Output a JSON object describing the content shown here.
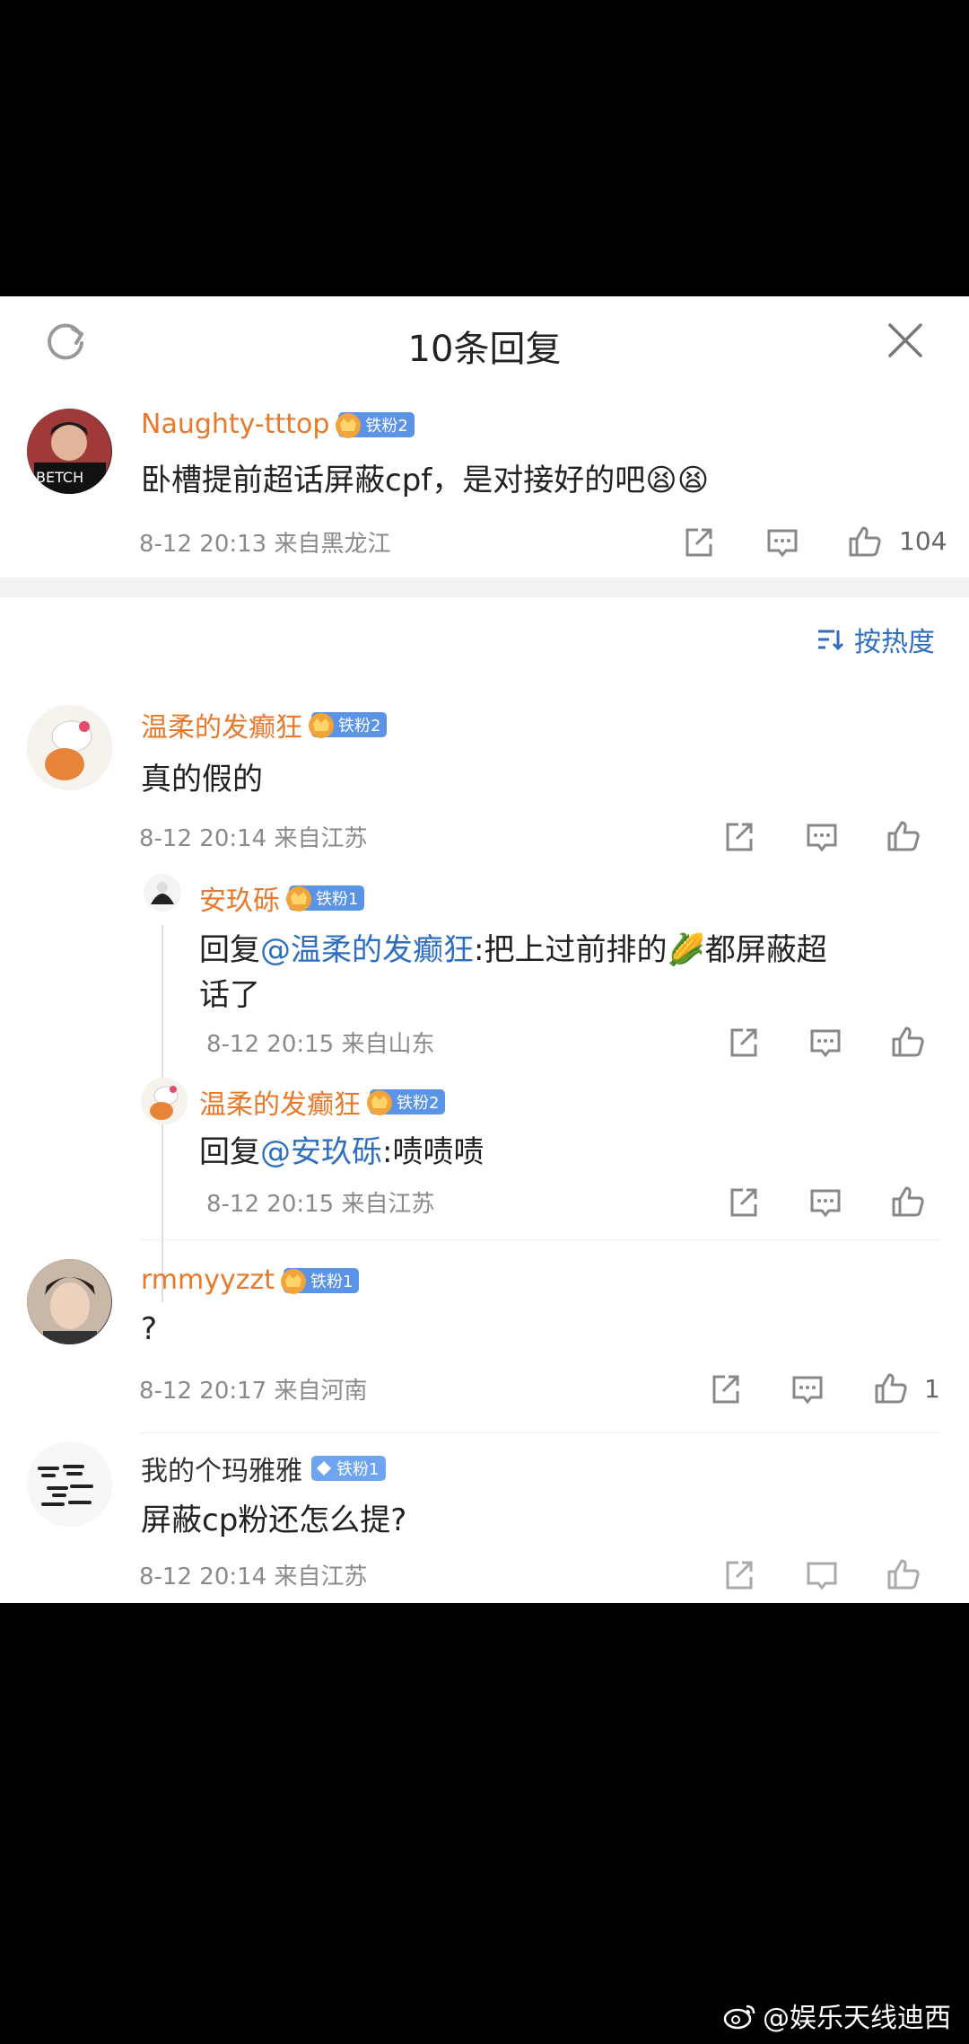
{
  "header": {
    "title": "10条回复"
  },
  "main_comment": {
    "user": "Naughty-tttop",
    "badge": "铁粉2",
    "text": "卧槽提前超话屏蔽cpf，是对接好的吧😫😫",
    "meta": "8-12 20:13 来自黑龙江",
    "likes": "104"
  },
  "sort": {
    "label": "按热度"
  },
  "replies": [
    {
      "user": "温柔的发癫狂",
      "badge": "铁粉2",
      "text": "真的假的",
      "meta": "8-12 20:14 来自江苏"
    },
    {
      "user": "安玖砾",
      "badge": "铁粉1",
      "prefix": "回复",
      "mention": "@温柔的发癫狂",
      "text_line1": ":把上过前排的🌽都屏蔽超",
      "text_line2": "话了",
      "meta": "8-12 20:15 来自山东"
    },
    {
      "user": "温柔的发癫狂",
      "badge": "铁粉2",
      "prefix": "回复",
      "mention": "@安玖砾",
      "text": ":啧啧啧",
      "meta": "8-12 20:15 来自江苏"
    },
    {
      "user": "rmmyyzzt",
      "badge": "铁粉1",
      "text": "?",
      "meta": "8-12 20:17 来自河南",
      "likes": "1"
    },
    {
      "user": "我的个玛雅雅",
      "badge": "铁粉1",
      "text": "屏蔽cp粉还怎么提?",
      "meta": "8-12 20:14 来自江苏"
    }
  ],
  "footer": {
    "text": "@娱乐天线迪西"
  },
  "colors": {
    "username": "#e8782a",
    "mention": "#2f6fbf",
    "badge": "#5b93e6"
  }
}
